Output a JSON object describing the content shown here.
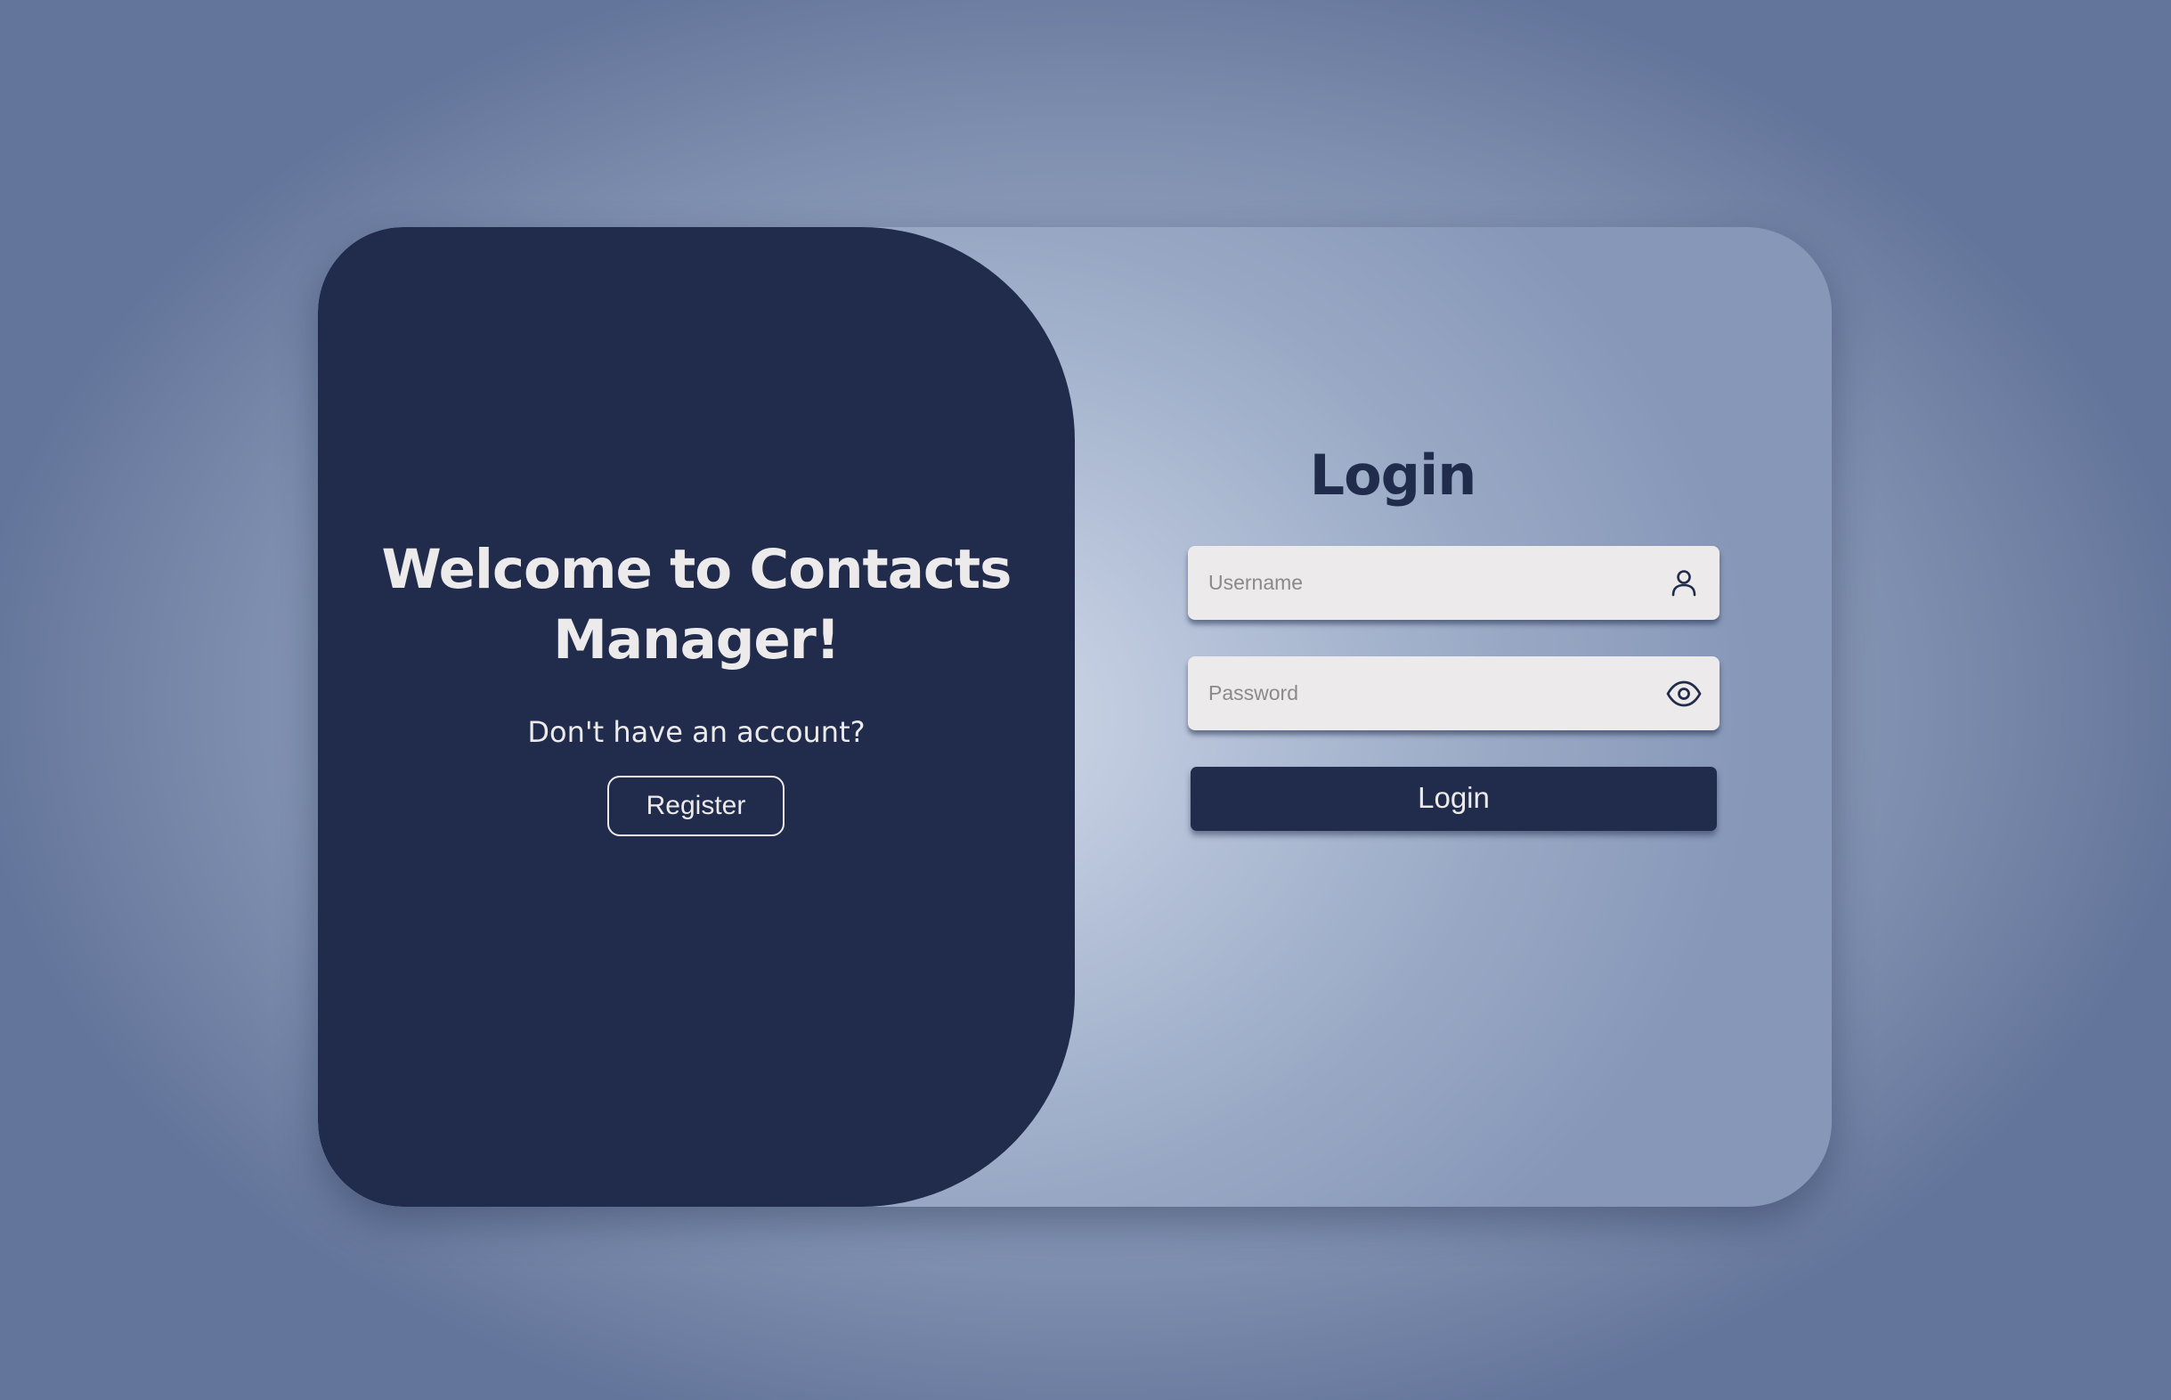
{
  "welcome": {
    "title": "Welcome to Contacts Manager!",
    "account_prompt": "Don't have an account?",
    "register_label": "Register"
  },
  "login": {
    "title": "Login",
    "username": {
      "value": "",
      "placeholder": "Username",
      "icon": "user-icon"
    },
    "password": {
      "value": "",
      "placeholder": "Password",
      "icon": "eye-icon"
    },
    "button_label": "Login"
  },
  "colors": {
    "primary_dark": "#212c4c",
    "light_text": "#eceaea",
    "input_background": "#eceaea",
    "placeholder_text": "#8a8a8a",
    "page_background": "#97a5c0",
    "card_background": "#b3c0d7"
  }
}
